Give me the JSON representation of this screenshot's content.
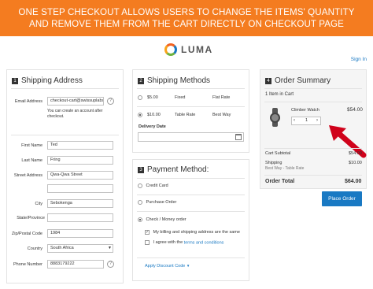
{
  "banner": {
    "line1": "ONE STEP CHECKOUT ALLOWS USERS TO CHANGE THE ITEMS' QUANTITY",
    "line2": "AND REMOVE THEM FROM THE CART DIRECTLY ON CHECKOUT PAGE"
  },
  "header": {
    "logo": "LUMA",
    "signin": "Sign In"
  },
  "shipping_address": {
    "number": "1",
    "title": "Shipping Address",
    "email_label": "Email Address",
    "email_value": "checkout-cart@swissuplabs.com",
    "email_hint": "You can create an account after checkout.",
    "first_name_label": "First Name",
    "first_name_value": "Ted",
    "last_name_label": "Last Name",
    "last_name_value": "Fring",
    "street_label": "Street Address",
    "street_value": "Qwa-Qwa Street",
    "city_label": "City",
    "city_value": "Sebokenga",
    "state_label": "State/Province",
    "zip_label": "Zip/Postal Code",
    "zip_value": "1984",
    "country_label": "Country",
    "country_value": "South Africa",
    "phone_label": "Phone Number",
    "phone_value": "8883179222"
  },
  "shipping_methods": {
    "number": "2",
    "title": "Shipping Methods",
    "methods": [
      {
        "price": "$5.00",
        "type": "Fixed",
        "carrier": "Flat Rate",
        "selected": false
      },
      {
        "price": "$10.00",
        "type": "Table Rate",
        "carrier": "Best Way",
        "selected": true
      }
    ],
    "delivery_date_label": "Delivery Date"
  },
  "payment": {
    "number": "3",
    "title": "Payment Method:",
    "options": [
      "Credit Card",
      "Purchase Order",
      "Check / Money order"
    ],
    "same_address": "My billing and shipping address are the same",
    "agree_prefix": "I agree with the ",
    "agree_link": "terms and conditions",
    "discount": "Apply Discount Code"
  },
  "order_summary": {
    "number": "4",
    "title": "Order Summary",
    "items_in_cart": "1 Item in Cart",
    "item_name": "Climber Watch",
    "item_price": "$54.00",
    "qty": "1",
    "cart_subtotal_label": "Cart Subtotal",
    "cart_subtotal_value": "$54.00",
    "shipping_label": "Shipping",
    "shipping_desc": "Best Way - Table Rate",
    "shipping_value": "$10.00",
    "order_total_label": "Order Total",
    "order_total_value": "$64.00",
    "place_order": "Place Order"
  },
  "colors": {
    "banner": "#f47c20",
    "primary": "#1979c3",
    "arrow": "#d0021b"
  },
  "icons": {
    "help": "question-icon",
    "calendar": "calendar-icon",
    "arrow": "annotation-arrow-icon"
  }
}
